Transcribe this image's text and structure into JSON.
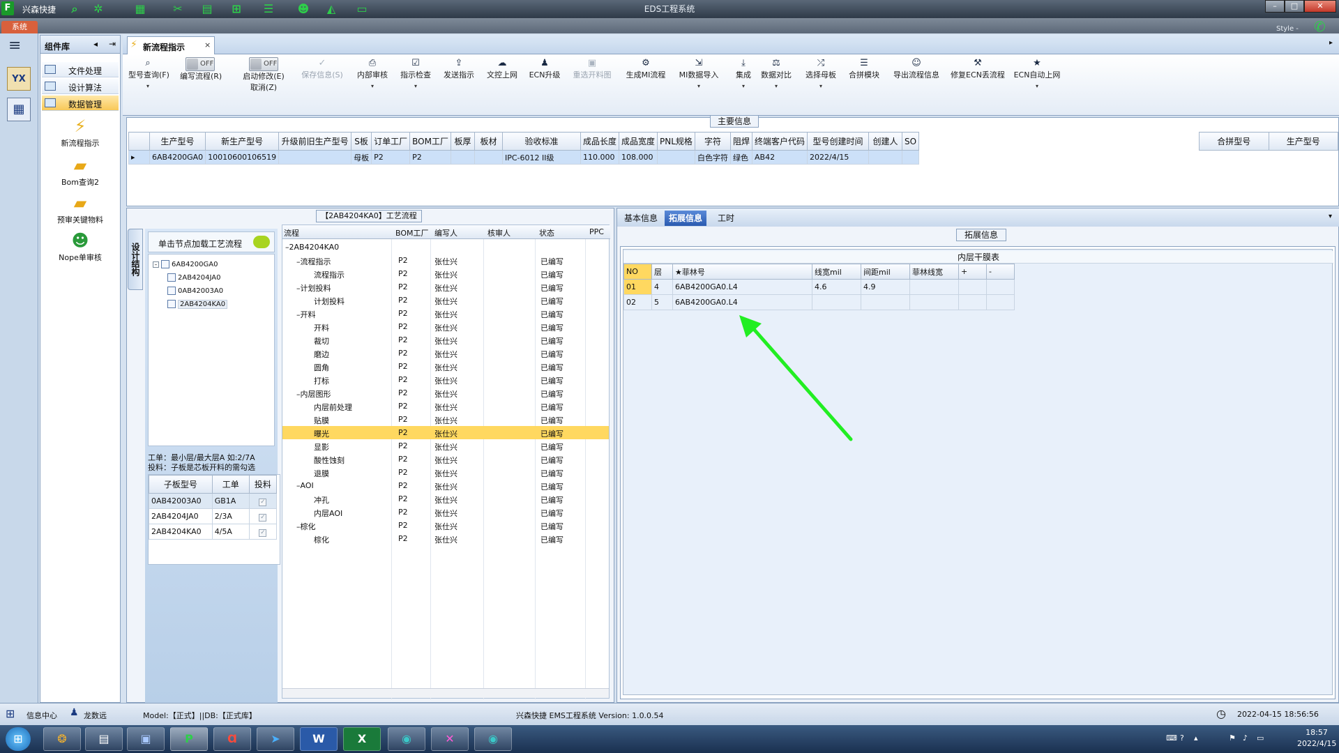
{
  "window": {
    "app_name": "兴森快捷",
    "title": "EDS工程系统",
    "sys_tab": "系统",
    "style_label": "Style -",
    "min": "–",
    "max": "□",
    "close": "✕"
  },
  "left_nav": {
    "yx_label": "YX"
  },
  "component_library": {
    "title": "组件库",
    "items": [
      {
        "label": "文件处理"
      },
      {
        "label": "设计算法"
      },
      {
        "label": "数据管理",
        "selected": true
      }
    ],
    "tiles": [
      {
        "label": "新流程指示",
        "icon": "lightning-icon"
      },
      {
        "label": "Bom查询2",
        "icon": "folder-icon"
      },
      {
        "label": "预审关键物料",
        "icon": "folder-icon"
      },
      {
        "label": "Nope单审核",
        "icon": "user-icon"
      }
    ]
  },
  "doc_tab": {
    "label": "新流程指示",
    "close": "×"
  },
  "toolbar": {
    "items": [
      {
        "label": "型号查询(F)",
        "icon": "search-icon",
        "dropdown": true
      },
      {
        "label": "编写流程(R)",
        "toggle": "OFF"
      },
      {
        "label": "启动修改(E)",
        "label2": "取消(Z)",
        "toggle": "OFF"
      },
      {
        "label": "保存信息(S)",
        "icon": "check-icon",
        "disabled": true
      },
      {
        "label": "内部审核",
        "icon": "print-icon",
        "dropdown": true
      },
      {
        "label": "指示检查",
        "icon": "checkbox-icon",
        "dropdown": true
      },
      {
        "label": "发送指示",
        "icon": "upload-icon"
      },
      {
        "label": "文控上网",
        "icon": "cloud-icon"
      },
      {
        "label": "ECN升级",
        "icon": "ecn-icon"
      },
      {
        "label": "重选开料图",
        "icon": "image-icon",
        "disabled": true
      },
      {
        "label": "生成MI流程",
        "icon": "gears-icon"
      },
      {
        "label": "MI数据导入",
        "icon": "import-icon",
        "dropdown": true
      },
      {
        "label": "集成",
        "icon": "download-icon",
        "dropdown": true
      },
      {
        "label": "数据对比",
        "icon": "compare-icon",
        "dropdown": true
      },
      {
        "label": "选择母板",
        "icon": "shuffle-icon",
        "dropdown": true
      },
      {
        "label": "合拼模块",
        "icon": "list-icon"
      },
      {
        "label": "导出流程信息",
        "icon": "smile-icon"
      },
      {
        "label": "修复ECN丢流程",
        "icon": "wrench-icon"
      },
      {
        "label": "ECN自动上网",
        "icon": "star-icon",
        "dropdown": true
      }
    ]
  },
  "main_info": {
    "legend": "主要信息",
    "columns": [
      "生产型号",
      "新生产型号",
      "升级前旧生产型号",
      "S板",
      "订单工厂",
      "BOM工厂",
      "板厚",
      "板材",
      "验收标准",
      "成品长度",
      "成品宽度",
      "PNL规格",
      "字符",
      "阻焊",
      "终端客户代码",
      "型号创建时间",
      "创建人",
      "SO"
    ],
    "rows": [
      [
        "6AB4200GA0",
        "10010600106519",
        "",
        "母板",
        "P2",
        "P2",
        "",
        "",
        "IPC-6012 II级",
        "110.000",
        "108.000",
        "",
        "白色字符",
        "绿色",
        "AB42",
        "2022/4/15",
        "",
        ""
      ]
    ],
    "merge_columns": [
      "合拼型号",
      "生产型号"
    ]
  },
  "struct_panel": {
    "vertical_tab": "设计结构",
    "hint": "单击节点加载工艺流程",
    "tree": [
      {
        "label": "6AB4200GA0",
        "level": 0
      },
      {
        "label": "2AB4204JA0",
        "level": 1
      },
      {
        "label": "0AB42003A0",
        "level": 1
      },
      {
        "label": "2AB4204KA0",
        "level": 1,
        "selected": true
      }
    ],
    "note_line1": "工单：最小层/最大层A 如:2/7A",
    "note_line2": "投料：子板是芯板开料的需勾选",
    "sub_columns": [
      "子板型号",
      "工单",
      "投料"
    ],
    "sub_rows": [
      {
        "model": "0AB42003A0",
        "order": "GB1A",
        "check": "✓"
      },
      {
        "model": "2AB4204JA0",
        "order": "2/3A",
        "check": "✓"
      },
      {
        "model": "2AB4204KA0",
        "order": "4/5A",
        "check": "✓"
      }
    ]
  },
  "process_flow": {
    "title": "【2AB4204KA0】工艺流程",
    "columns": [
      "流程",
      "BOM工厂",
      "编写人",
      "核审人",
      "状态",
      "PPC"
    ],
    "rows": [
      {
        "name": "2AB4204KA0",
        "level": 0,
        "kind": "root",
        "factory": "",
        "writer": "",
        "status": ""
      },
      {
        "name": "流程指示",
        "level": 1,
        "kind": "folder",
        "factory": "P2",
        "writer": "张仕兴",
        "status": "已编写"
      },
      {
        "name": "流程指示",
        "level": 2,
        "kind": "doc",
        "factory": "P2",
        "writer": "张仕兴",
        "status": "已编写"
      },
      {
        "name": "计划投料",
        "level": 1,
        "kind": "folder",
        "factory": "P2",
        "writer": "张仕兴",
        "status": "已编写"
      },
      {
        "name": "计划投料",
        "level": 2,
        "kind": "doc",
        "factory": "P2",
        "writer": "张仕兴",
        "status": "已编写"
      },
      {
        "name": "开料",
        "level": 1,
        "kind": "folder",
        "factory": "P2",
        "writer": "张仕兴",
        "status": "已编写"
      },
      {
        "name": "开料",
        "level": 2,
        "kind": "doc",
        "factory": "P2",
        "writer": "张仕兴",
        "status": "已编写"
      },
      {
        "name": "裁切",
        "level": 2,
        "kind": "doc",
        "factory": "P2",
        "writer": "张仕兴",
        "status": "已编写"
      },
      {
        "name": "磨边",
        "level": 2,
        "kind": "doc",
        "factory": "P2",
        "writer": "张仕兴",
        "status": "已编写"
      },
      {
        "name": "圆角",
        "level": 2,
        "kind": "doc",
        "factory": "P2",
        "writer": "张仕兴",
        "status": "已编写"
      },
      {
        "name": "打标",
        "level": 2,
        "kind": "doc",
        "factory": "P2",
        "writer": "张仕兴",
        "status": "已编写"
      },
      {
        "name": "内层图形",
        "level": 1,
        "kind": "folder",
        "factory": "P2",
        "writer": "张仕兴",
        "status": "已编写"
      },
      {
        "name": "内层前处理",
        "level": 2,
        "kind": "doc",
        "factory": "P2",
        "writer": "张仕兴",
        "status": "已编写"
      },
      {
        "name": "贴膜",
        "level": 2,
        "kind": "doc",
        "factory": "P2",
        "writer": "张仕兴",
        "status": "已编写"
      },
      {
        "name": "曝光",
        "level": 2,
        "kind": "doc",
        "factory": "P2",
        "writer": "张仕兴",
        "status": "已编写",
        "selected": true
      },
      {
        "name": "显影",
        "level": 2,
        "kind": "doc",
        "factory": "P2",
        "writer": "张仕兴",
        "status": "已编写"
      },
      {
        "name": "酸性蚀刻",
        "level": 2,
        "kind": "doc",
        "factory": "P2",
        "writer": "张仕兴",
        "status": "已编写"
      },
      {
        "name": "退膜",
        "level": 2,
        "kind": "doc",
        "factory": "P2",
        "writer": "张仕兴",
        "status": "已编写"
      },
      {
        "name": "AOI",
        "level": 1,
        "kind": "folder",
        "factory": "P2",
        "writer": "张仕兴",
        "status": "已编写"
      },
      {
        "name": "冲孔",
        "level": 2,
        "kind": "doc",
        "factory": "P2",
        "writer": "张仕兴",
        "status": "已编写"
      },
      {
        "name": "内层AOI",
        "level": 2,
        "kind": "doc",
        "factory": "P2",
        "writer": "张仕兴",
        "status": "已编写"
      },
      {
        "name": "棕化",
        "level": 1,
        "kind": "folder",
        "factory": "P2",
        "writer": "张仕兴",
        "status": "已编写"
      },
      {
        "name": "棕化",
        "level": 2,
        "kind": "doc",
        "factory": "P2",
        "writer": "张仕兴",
        "status": "已编写"
      }
    ]
  },
  "right_panel": {
    "tabs": [
      {
        "label": "基本信息"
      },
      {
        "label": "拓展信息",
        "active": true
      },
      {
        "label": "工时"
      }
    ],
    "legend": "拓展信息",
    "table_title": "内层干膜表",
    "columns": [
      "NO",
      "层",
      "★菲林号",
      "线宽mil",
      "间距mil",
      "菲林线宽",
      "+",
      "-"
    ],
    "rows": [
      [
        "01",
        "4",
        "6AB4200GA0.L4",
        "4.6",
        "4.9",
        "",
        "",
        ""
      ],
      [
        "02",
        "5",
        "6AB4200GA0.L4",
        "",
        "",
        "",
        "",
        ""
      ]
    ]
  },
  "status_bar": {
    "info_center": "信息中心",
    "user": "龙数远",
    "model_db": "Model:【正式】||DB:【正式库】",
    "version": "兴森快捷 EMS工程系统 Version: 1.0.0.54",
    "datetime": "2022-04-15 18:56:56"
  },
  "taskbar": {
    "time": "18:57",
    "date": "2022/4/15"
  },
  "colors": {
    "accent": "#2a5ab0",
    "selected_row": "#ffd860",
    "arrow": "#22ee22"
  }
}
